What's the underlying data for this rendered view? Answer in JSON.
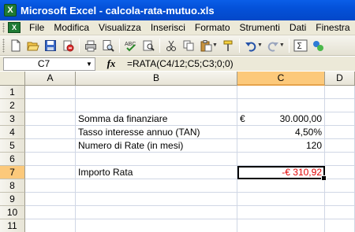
{
  "window": {
    "title": "Microsoft Excel - calcola-rata-mutuo.xls",
    "app_icon_text": "X"
  },
  "menu": {
    "items": [
      {
        "label": "File",
        "name": "menu-file"
      },
      {
        "label": "Modifica",
        "name": "menu-modifica"
      },
      {
        "label": "Visualizza",
        "name": "menu-visualizza"
      },
      {
        "label": "Inserisci",
        "name": "menu-inserisci"
      },
      {
        "label": "Formato",
        "name": "menu-formato"
      },
      {
        "label": "Strumenti",
        "name": "menu-strumenti"
      },
      {
        "label": "Dati",
        "name": "menu-dati"
      },
      {
        "label": "Finestra",
        "name": "menu-finestra"
      }
    ]
  },
  "toolbar": {
    "icons": [
      "new-icon",
      "open-icon",
      "save-icon",
      "permission-icon",
      "print-icon",
      "print-preview-icon",
      "spelling-icon",
      "research-icon",
      "cut-icon",
      "copy-icon",
      "paste-icon",
      "format-painter-icon",
      "undo-icon",
      "redo-icon",
      "sum-icon",
      "help-icon"
    ]
  },
  "formula_bar": {
    "name_box": "C7",
    "fx_label": "fx",
    "formula": "=RATA(C4/12;C5;C3;0;0)"
  },
  "sheet": {
    "columns": [
      "A",
      "B",
      "C",
      "D"
    ],
    "active_column": "C",
    "active_row": "7",
    "rows": [
      {
        "num": "1",
        "b": "",
        "c_sym": "",
        "c": ""
      },
      {
        "num": "2",
        "b": "",
        "c_sym": "",
        "c": ""
      },
      {
        "num": "3",
        "b": "Somma da finanziare",
        "c_sym": "€",
        "c": "30.000,00"
      },
      {
        "num": "4",
        "b": "Tasso interesse annuo (TAN)",
        "c_sym": "",
        "c": "4,50%"
      },
      {
        "num": "5",
        "b": "Numero di Rate (in mesi)",
        "c_sym": "",
        "c": "120"
      },
      {
        "num": "6",
        "b": "",
        "c_sym": "",
        "c": ""
      },
      {
        "num": "7",
        "b": "Importo Rata",
        "c_sym": "",
        "c": "-€ 310,92"
      },
      {
        "num": "8",
        "b": "",
        "c_sym": "",
        "c": ""
      },
      {
        "num": "9",
        "b": "",
        "c_sym": "",
        "c": ""
      },
      {
        "num": "10",
        "b": "",
        "c_sym": "",
        "c": ""
      },
      {
        "num": "11",
        "b": "",
        "c_sym": "",
        "c": ""
      }
    ]
  },
  "colors": {
    "titlebar": "#0451d9",
    "negative": "#e00000",
    "active_header": "#fcc97b"
  }
}
